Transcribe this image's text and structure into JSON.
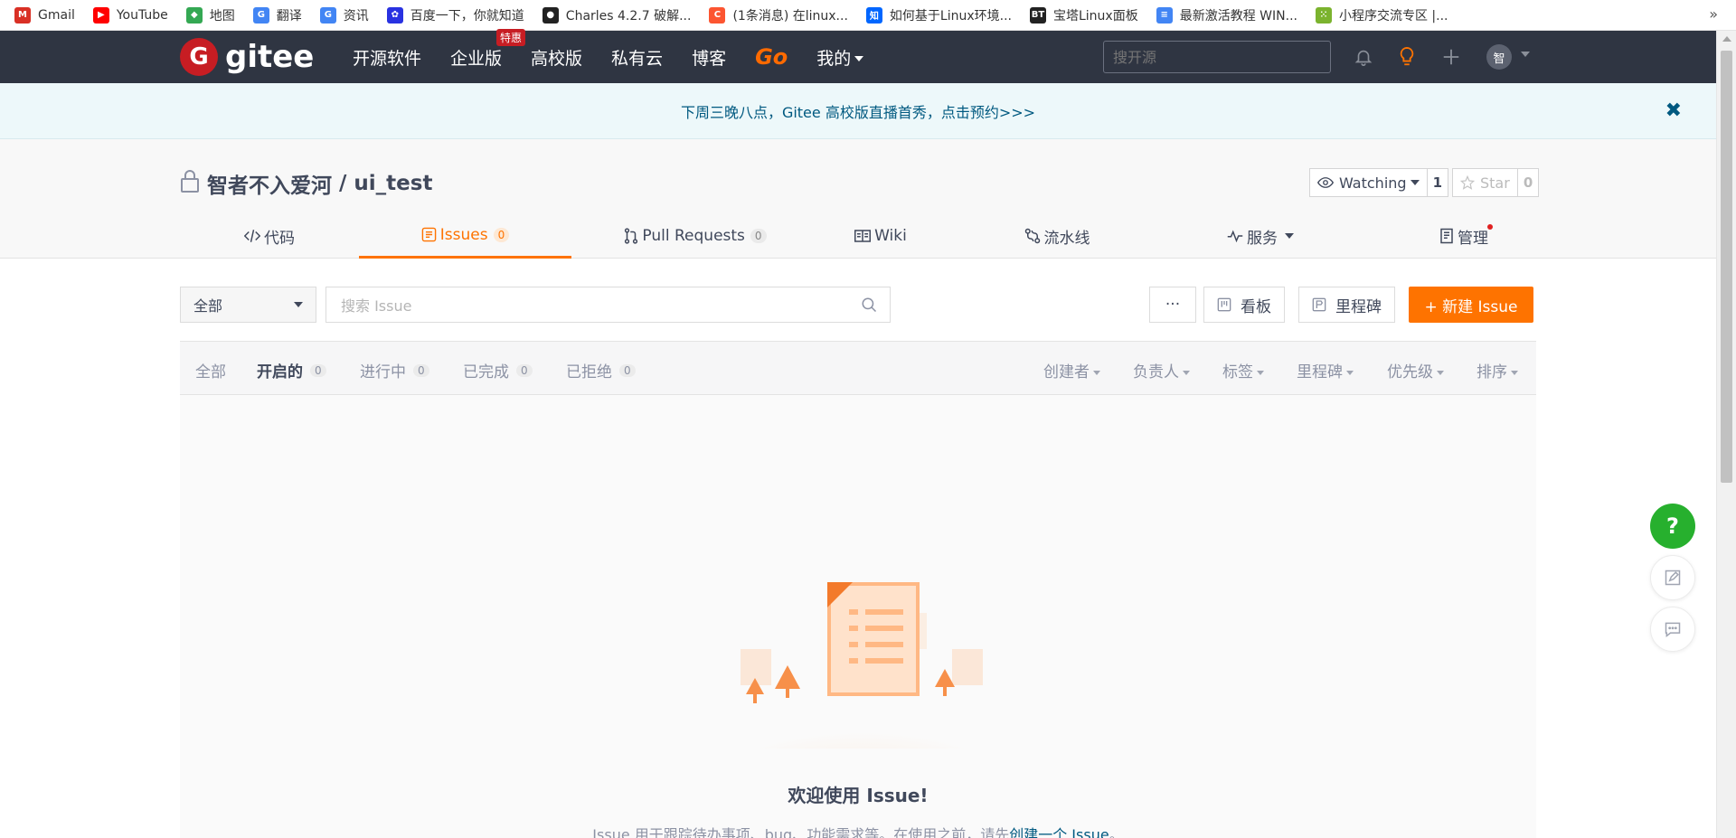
{
  "bookmarks": [
    {
      "label": "Gmail",
      "icon": "gmail-icon",
      "color": "#d93025",
      "glyph": "M"
    },
    {
      "label": "YouTube",
      "icon": "youtube-icon",
      "color": "#ff0000",
      "glyph": "▶"
    },
    {
      "label": "地图",
      "icon": "maps-icon",
      "color": "#34a853",
      "glyph": "◆"
    },
    {
      "label": "翻译",
      "icon": "translate-icon",
      "color": "#4285f4",
      "glyph": "G"
    },
    {
      "label": "资讯",
      "icon": "news-icon",
      "color": "#4285f4",
      "glyph": "G"
    },
    {
      "label": "百度一下，你就知道",
      "icon": "baidu-icon",
      "color": "#2932e1",
      "glyph": "✿"
    },
    {
      "label": "Charles 4.2.7 破解...",
      "icon": "github-icon",
      "color": "#222222",
      "glyph": "●"
    },
    {
      "label": "(1条消息) 在linux...",
      "icon": "csdn-icon",
      "color": "#fc5531",
      "glyph": "C"
    },
    {
      "label": "如何基于Linux环境...",
      "icon": "zhihu-icon",
      "color": "#0066ff",
      "glyph": "知"
    },
    {
      "label": "宝塔Linux面板",
      "icon": "bt-icon",
      "color": "#222222",
      "glyph": "BT"
    },
    {
      "label": "最新激活教程 WIN...",
      "icon": "doc-icon",
      "color": "#4285f4",
      "glyph": "≡"
    },
    {
      "label": "小程序交流专区 |...",
      "icon": "miniprogram-icon",
      "color": "#7bb32e",
      "glyph": "⁙"
    }
  ],
  "bookmarks_more": "»",
  "nav": {
    "logo_glyph": "G",
    "logo_text": "gitee",
    "links": [
      "开源软件",
      "企业版",
      "高校版",
      "私有云",
      "博客",
      "Go",
      "我的"
    ],
    "hot_badge": "特惠",
    "search_placeholder": "搜开源",
    "avatar_text": "智"
  },
  "announcement": {
    "text": "下周三晚八点，Gitee 高校版直播首秀，点击预约>>>",
    "close": "✖"
  },
  "repo": {
    "owner": "智者不入爱河",
    "separator": " / ",
    "name": "ui_test",
    "watching_label": "Watching",
    "watching_count": "1",
    "star_label": "Star",
    "star_count": "0"
  },
  "tabs": [
    {
      "label": "代码",
      "icon": "code-icon"
    },
    {
      "label": "Issues",
      "count": "0",
      "icon": "issues-icon",
      "active": true
    },
    {
      "label": "Pull Requests",
      "count": "0",
      "icon": "pull-request-icon"
    },
    {
      "label": "Wiki",
      "icon": "wiki-icon"
    },
    {
      "label": "流水线",
      "icon": "pipeline-icon"
    },
    {
      "label": "服务",
      "icon": "service-icon"
    },
    {
      "label": "管理",
      "icon": "manage-icon"
    }
  ],
  "toolbar": {
    "scope_select": "全部",
    "search_placeholder": "搜索 Issue",
    "more": "···",
    "kanban": "看板",
    "milestone": "里程碑",
    "new_issue": "+ 新建 Issue"
  },
  "states": [
    {
      "label": "全部"
    },
    {
      "label": "开启的",
      "count": "0",
      "active": true
    },
    {
      "label": "进行中",
      "count": "0"
    },
    {
      "label": "已完成",
      "count": "0"
    },
    {
      "label": "已拒绝",
      "count": "0"
    }
  ],
  "filters": [
    "创建者",
    "负责人",
    "标签",
    "里程碑",
    "优先级",
    "排序"
  ],
  "empty": {
    "title": "欢迎使用 Issue!",
    "desc_prefix": "Issue 用于跟踪待办事项、bug、功能需求等。在使用之前，请先",
    "desc_link": "创建一个 Issue",
    "desc_suffix": "。"
  },
  "floating": {
    "help": "?"
  },
  "colors": {
    "accent": "#fe7300",
    "nav_bg": "#2f3542",
    "brand_red": "#c71d23",
    "help_green": "#27b02e",
    "link": "#005980"
  }
}
